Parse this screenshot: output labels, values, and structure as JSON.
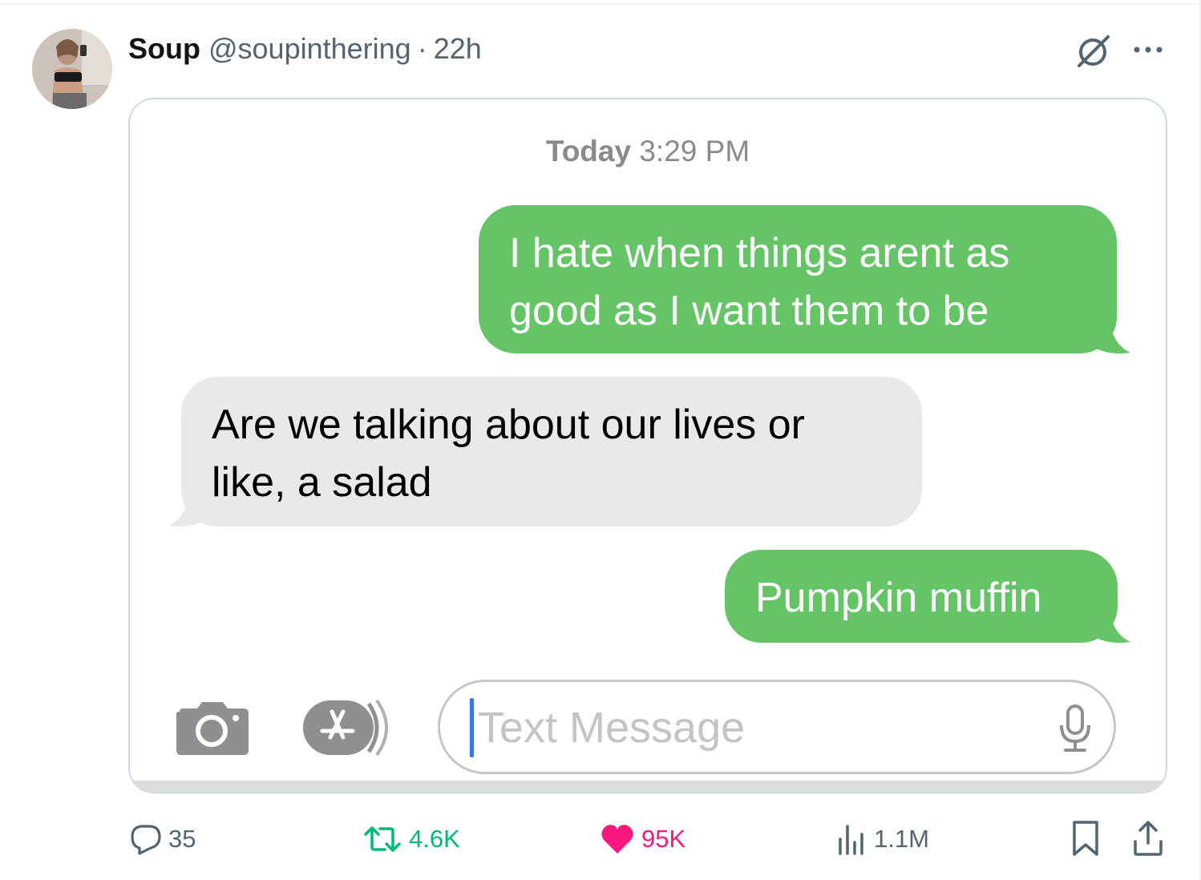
{
  "tweet": {
    "author_name": "Soup",
    "author_handle": "@soupinthering",
    "separator": "·",
    "time_ago": "22h"
  },
  "icons": {
    "avatar": "avatar",
    "grok": "grok-icon",
    "more": "more-icon",
    "reply": "reply-icon",
    "retweet": "retweet-icon",
    "like": "heart-icon",
    "views": "views-icon",
    "bookmark": "bookmark-icon",
    "share": "share-icon"
  },
  "screenshot": {
    "timestamp_day": "Today",
    "timestamp_time": "3:29 PM",
    "messages": [
      {
        "direction": "sent",
        "lines": [
          "I hate when things arent as",
          "good as I want them to be"
        ]
      },
      {
        "direction": "received",
        "lines": [
          "Are we talking about our lives or",
          "like, a salad"
        ]
      },
      {
        "direction": "sent",
        "lines": [
          "Pumpkin muffin"
        ]
      }
    ],
    "composer": {
      "placeholder": "Text Message",
      "icons": [
        "camera-icon",
        "app-store-icon",
        "mic-icon"
      ]
    },
    "colors": {
      "sent_bubble": "#65c466",
      "received_bubble": "#e9e9eb",
      "caret": "#3478f6"
    }
  },
  "stats": {
    "replies": "35",
    "retweets": "4.6K",
    "likes": "95K",
    "views": "1.1M"
  },
  "colors": {
    "retweet": "#00ba7c",
    "like": "#f91880",
    "muted": "#536471"
  }
}
